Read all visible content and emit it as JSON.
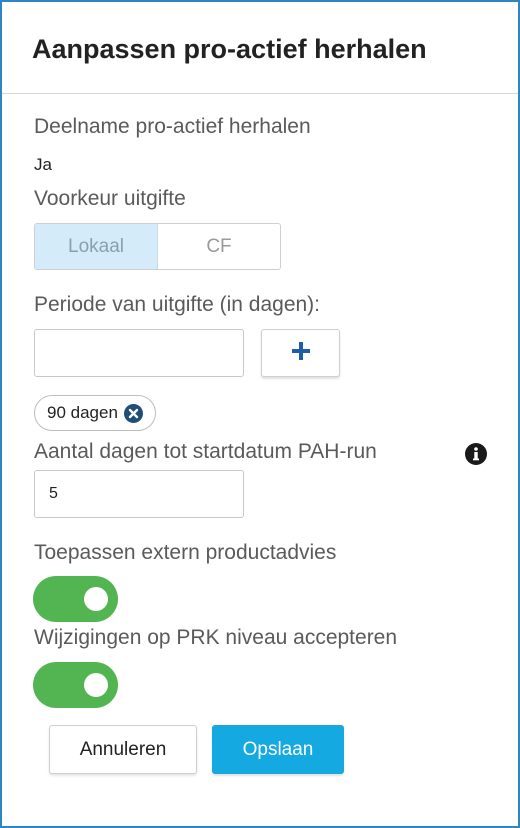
{
  "dialog": {
    "title": "Aanpassen pro-actief herhalen"
  },
  "participation": {
    "label": "Deelname pro-actief herhalen",
    "value": "Ja"
  },
  "issue_preference": {
    "label": "Voorkeur uitgifte",
    "options": [
      "Lokaal",
      "CF"
    ],
    "selected": "Lokaal"
  },
  "issue_period": {
    "label": "Periode van uitgifte (in dagen):",
    "input_value": "",
    "add_icon": "plus-icon",
    "chips": [
      {
        "label": "90 dagen",
        "remove_icon": "remove-circle-icon"
      }
    ]
  },
  "days_to_start": {
    "label": "Aantal dagen tot startdatum PAH-run",
    "value": "5",
    "info_icon": "info-circle-icon"
  },
  "external_advice": {
    "label": "Toepassen extern productadvies",
    "enabled": true
  },
  "prk_changes": {
    "label": "Wijzigingen op PRK niveau accepteren",
    "enabled": true
  },
  "actions": {
    "cancel_label": "Annuleren",
    "save_label": "Opslaan"
  },
  "colors": {
    "border": "#2e86c1",
    "segment_active": "#d4ecf9",
    "toggle_on": "#52b552",
    "primary": "#14a9e1",
    "add_icon": "#1b5fa6",
    "chip_remove": "#1f4e79"
  }
}
